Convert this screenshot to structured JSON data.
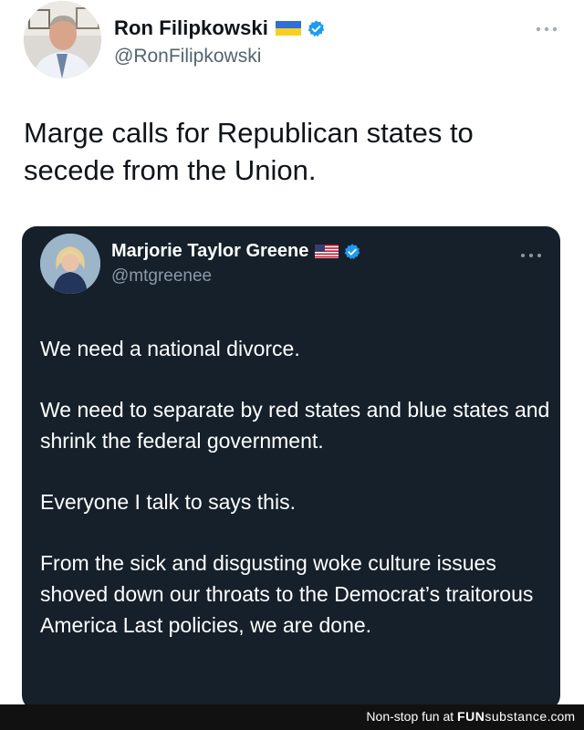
{
  "tweet": {
    "author": {
      "display_name": "Ron Filipkowski",
      "handle": "@RonFilipkowski",
      "flag_icon": "ukraine-flag-icon",
      "verified_icon": "verified-badge-icon"
    },
    "text": "Marge calls for Republican states to secede from the Union.",
    "more_icon": "more-options-icon"
  },
  "quoted_tweet": {
    "author": {
      "display_name": "Marjorie Taylor Greene",
      "handle": "@mtgreenee",
      "flag_icon": "us-flag-icon",
      "verified_icon": "verified-badge-icon"
    },
    "paragraphs": [
      "We need a national divorce.",
      "We need to separate by red states and blue states and shrink the federal government.",
      "Everyone I talk to says this.",
      "From the sick and disgusting woke culture issues shoved down our throats to the Democrat’s traitorous America Last policies, we are done."
    ],
    "more_icon": "more-options-icon"
  },
  "watermark": {
    "prefix": "Non-stop fun at ",
    "brand_bold": "FUN",
    "brand_rest": "substance",
    "suffix": ".com"
  },
  "colors": {
    "verified_blue": "#1d9bf0",
    "quote_background": "#15202b",
    "handle_gray": "#536471"
  }
}
